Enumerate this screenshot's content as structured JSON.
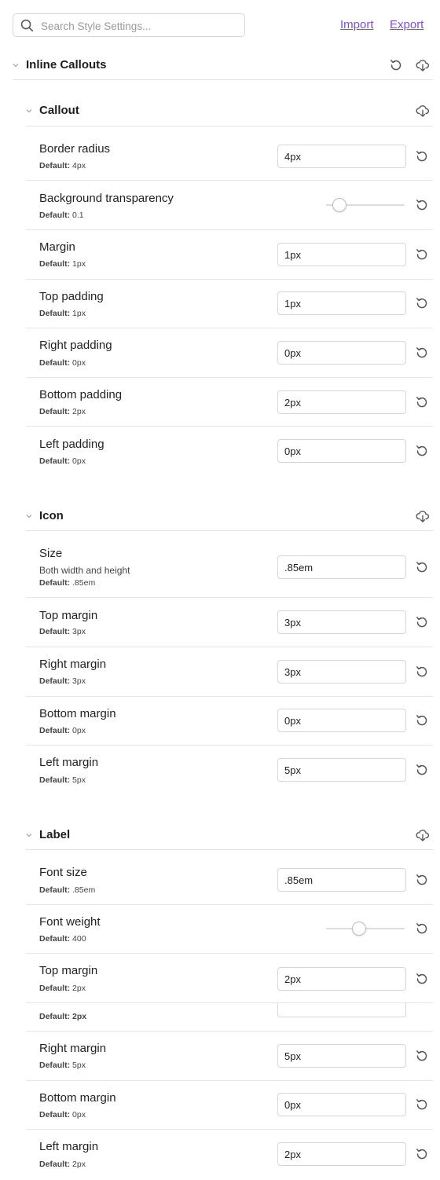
{
  "toolbar": {
    "search_placeholder": "Search Style Settings...",
    "import_label": "Import",
    "export_label": "Export"
  },
  "group": {
    "title": "Inline Callouts"
  },
  "default_prefix": "Default:",
  "sections": {
    "callout": {
      "title": "Callout",
      "rows": [
        {
          "label": "Border radius",
          "default": "4px",
          "value": "4px"
        },
        {
          "label": "Background transparency",
          "default": "0.1",
          "slider": 0.1
        },
        {
          "label": "Margin",
          "default": "1px",
          "value": "1px"
        },
        {
          "label": "Top padding",
          "default": "1px",
          "value": "1px"
        },
        {
          "label": "Right padding",
          "default": "0px",
          "value": "0px"
        },
        {
          "label": "Bottom padding",
          "default": "2px",
          "value": "2px"
        },
        {
          "label": "Left padding",
          "default": "0px",
          "value": "0px"
        }
      ]
    },
    "icon": {
      "title": "Icon",
      "rows": [
        {
          "label": "Size",
          "desc": "Both width and height",
          "default": ".85em",
          "value": ".85em"
        },
        {
          "label": "Top margin",
          "default": "3px",
          "value": "3px"
        },
        {
          "label": "Right margin",
          "default": "3px",
          "value": "3px"
        },
        {
          "label": "Bottom margin",
          "default": "0px",
          "value": "0px"
        },
        {
          "label": "Left margin",
          "default": "5px",
          "value": "5px"
        }
      ]
    },
    "label": {
      "title": "Label",
      "rows": [
        {
          "label": "Font size",
          "default": ".85em",
          "value": ".85em"
        },
        {
          "label": "Font weight",
          "default": "400",
          "slider": 0.4
        },
        {
          "label": "Top margin",
          "default": "2px",
          "value": "2px"
        },
        {
          "label": "Right margin",
          "default": "5px",
          "value": "5px"
        },
        {
          "label": "Bottom margin",
          "default": "0px",
          "value": "0px"
        },
        {
          "label": "Left margin",
          "default": "2px",
          "value": "2px"
        }
      ],
      "partial_default": "Default: 2px"
    }
  },
  "icons": {
    "search": "search-icon",
    "chevron": "chevron-down-icon",
    "reset": "reset-icon",
    "export": "export-icon"
  },
  "colors": {
    "link": "#7b4fd6",
    "border": "#d6d6d6",
    "divider": "#e6e6e6"
  }
}
